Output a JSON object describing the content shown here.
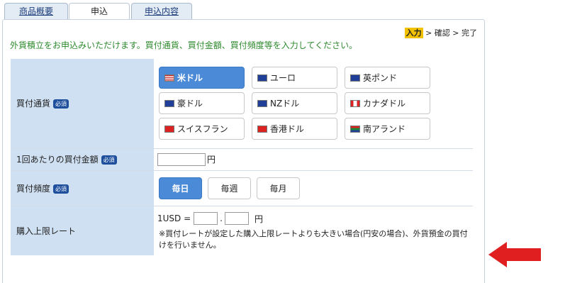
{
  "tabs": {
    "overview": "商品概要",
    "apply": "申込",
    "content": "申込内容"
  },
  "steps": {
    "current": "入力",
    "rest": " > 確認 > 完了"
  },
  "intro": "外貨積立をお申込みいただけます。買付通貨、買付金額、買付頻度等を入力してください。",
  "required_badge": "必須",
  "form": {
    "currency_label": "買付通貨",
    "amount_label": "1回あたりの買付金額",
    "amount_unit": "円",
    "frequency_label": "買付頻度",
    "limit_label": "購入上限レート",
    "limit_prefix": "1USD =",
    "limit_dot": ".",
    "limit_unit": "円",
    "limit_note": "※買付レートが設定した購入上限レートよりも大きい場合(円安の場合)、外貨預金の買付けを行いません。"
  },
  "currencies": [
    {
      "label": "米ドル",
      "flag": "us-flag",
      "selected": true
    },
    {
      "label": "ユーロ",
      "flag": "eu-flag",
      "selected": false
    },
    {
      "label": "英ポンド",
      "flag": "uk-flag",
      "selected": false
    },
    {
      "label": "豪ドル",
      "flag": "au-flag",
      "selected": false
    },
    {
      "label": "NZドル",
      "flag": "nz-flag",
      "selected": false
    },
    {
      "label": "カナダドル",
      "flag": "ca-flag",
      "selected": false
    },
    {
      "label": "スイスフラン",
      "flag": "ch-flag",
      "selected": false
    },
    {
      "label": "香港ドル",
      "flag": "hk-flag",
      "selected": false
    },
    {
      "label": "南アランド",
      "flag": "za-flag",
      "selected": false
    }
  ],
  "frequencies": [
    {
      "label": "毎日",
      "selected": true
    },
    {
      "label": "毎週",
      "selected": false
    },
    {
      "label": "毎月",
      "selected": false
    }
  ],
  "colors": {
    "accent": "#4a8ad6",
    "label_bg": "#cfe0f2",
    "arrow": "#e02020",
    "intro": "#2e8a2e"
  }
}
